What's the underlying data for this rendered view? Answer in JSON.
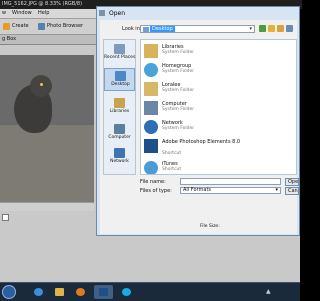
{
  "background_app": {
    "title": "IMG_5162.JPG @ 8.33% (RGB/8)",
    "menu": [
      "w",
      "Window",
      "Help"
    ],
    "toolbar": {
      "create_label": "Create",
      "photo_browser_label": "Photo Browser"
    },
    "panel_tab": "g Box"
  },
  "dialog": {
    "title": "Open",
    "look_in_label": "Look in:",
    "look_in_value": "Desktop",
    "places": [
      {
        "label": "Recent Places",
        "icon": "recent-places-icon"
      },
      {
        "label": "Desktop",
        "icon": "desktop-icon",
        "selected": true
      },
      {
        "label": "Libraries",
        "icon": "libraries-icon"
      },
      {
        "label": "Computer",
        "icon": "computer-icon"
      },
      {
        "label": "Network",
        "icon": "network-icon"
      }
    ],
    "items": [
      {
        "name": "Libraries",
        "sub": "System Folder",
        "icon": "libraries-icon"
      },
      {
        "name": "Homegroup",
        "sub": "System Folder",
        "icon": "homegroup-icon"
      },
      {
        "name": "Loralee",
        "sub": "System Folder",
        "icon": "user-folder-icon"
      },
      {
        "name": "Computer",
        "sub": "System Folder",
        "icon": "computer-icon"
      },
      {
        "name": "Network",
        "sub": "System Folder",
        "icon": "network-icon"
      },
      {
        "name": "Adobe Photoshop Elements 8.0",
        "sub": "Shortcut",
        "icon": "photoshop-elements-icon"
      },
      {
        "name": "iTunes",
        "sub": "Shortcut",
        "icon": "itunes-icon"
      }
    ],
    "file_name_label": "File name:",
    "file_name_value": "",
    "files_of_type_label": "Files of type:",
    "files_of_type_value": "All Formats",
    "open_button": "Open",
    "cancel_button": "Cancel",
    "file_size_label": "File Size:"
  },
  "taskbar": {
    "apps": [
      "start-orb",
      "ie-icon",
      "explorer-icon",
      "media-player-icon",
      "photoshop-elements-icon",
      "skype-icon"
    ]
  },
  "colors": {
    "accent": "#3399ff",
    "dialog_frame": "#d7e4f2",
    "taskbar": "#1b2a3b"
  }
}
